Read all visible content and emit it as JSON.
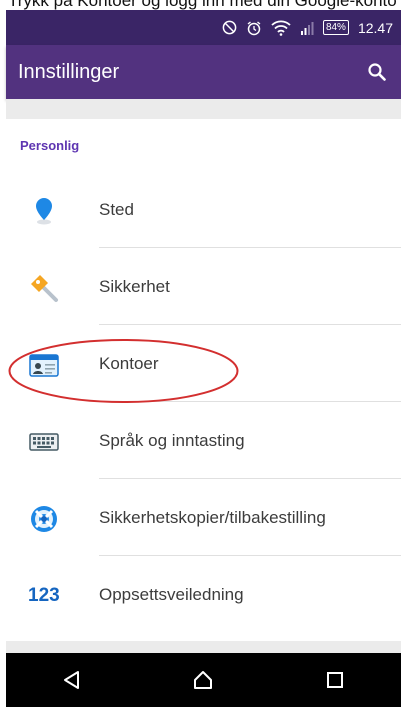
{
  "caption": "Trykk på Kontoer og logg inn med din Google-konto",
  "statusbar": {
    "battery": "84%",
    "time": "12.47"
  },
  "appbar": {
    "title": "Innstillinger"
  },
  "section": {
    "title": "Personlig"
  },
  "items": [
    {
      "label": "Sted",
      "icon": "location-pin-icon"
    },
    {
      "label": "Sikkerhet",
      "icon": "key-icon"
    },
    {
      "label": "Kontoer",
      "icon": "id-card-icon"
    },
    {
      "label": "Språk og inntasting",
      "icon": "keyboard-icon"
    },
    {
      "label": "Sikkerhetskopier/tilbakestilling",
      "icon": "backup-lifebuoy-icon"
    },
    {
      "label": "Oppsettsveiledning",
      "icon": "123-icon"
    }
  ],
  "icon_text": {
    "numbers": "123"
  },
  "colors": {
    "statusbar": "#3a2566",
    "appbar": "#52327f",
    "section": "#5e35b1",
    "annotation": "#d32f2f"
  }
}
